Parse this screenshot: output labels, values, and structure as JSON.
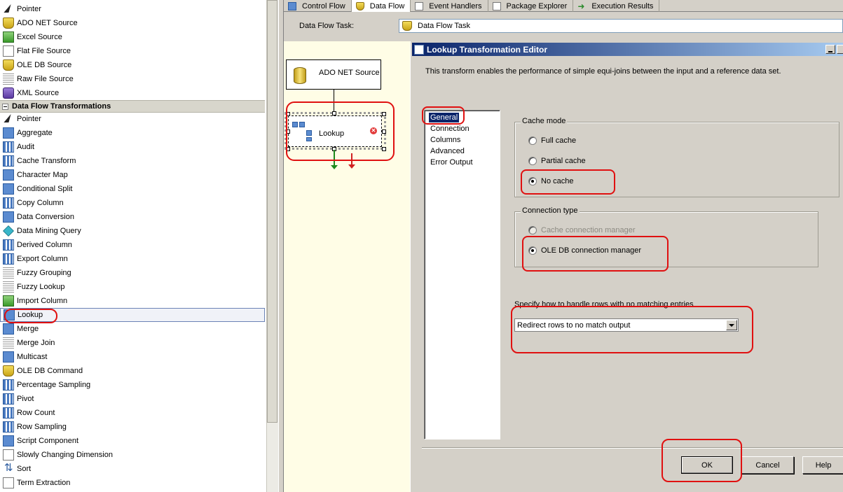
{
  "toolbox": {
    "sources": [
      {
        "label": "Pointer",
        "icon": "pointer-icon"
      },
      {
        "label": "ADO NET Source",
        "icon": "ado-net-source-icon"
      },
      {
        "label": "Excel Source",
        "icon": "excel-source-icon"
      },
      {
        "label": "Flat File Source",
        "icon": "flat-file-source-icon"
      },
      {
        "label": "OLE DB Source",
        "icon": "ole-db-source-icon"
      },
      {
        "label": "Raw File Source",
        "icon": "raw-file-source-icon"
      },
      {
        "label": "XML Source",
        "icon": "xml-source-icon"
      }
    ],
    "transformations_header": "Data Flow Transformations",
    "transformations": [
      {
        "label": "Pointer",
        "icon": "pointer-icon"
      },
      {
        "label": "Aggregate",
        "icon": "aggregate-icon"
      },
      {
        "label": "Audit",
        "icon": "audit-icon"
      },
      {
        "label": "Cache Transform",
        "icon": "cache-transform-icon"
      },
      {
        "label": "Character Map",
        "icon": "character-map-icon"
      },
      {
        "label": "Conditional Split",
        "icon": "conditional-split-icon"
      },
      {
        "label": "Copy Column",
        "icon": "copy-column-icon"
      },
      {
        "label": "Data Conversion",
        "icon": "data-conversion-icon"
      },
      {
        "label": "Data Mining Query",
        "icon": "data-mining-query-icon"
      },
      {
        "label": "Derived Column",
        "icon": "derived-column-icon"
      },
      {
        "label": "Export Column",
        "icon": "export-column-icon"
      },
      {
        "label": "Fuzzy Grouping",
        "icon": "fuzzy-grouping-icon"
      },
      {
        "label": "Fuzzy Lookup",
        "icon": "fuzzy-lookup-icon"
      },
      {
        "label": "Import Column",
        "icon": "import-column-icon"
      },
      {
        "label": "Lookup",
        "icon": "lookup-icon"
      },
      {
        "label": "Merge",
        "icon": "merge-icon"
      },
      {
        "label": "Merge Join",
        "icon": "merge-join-icon"
      },
      {
        "label": "Multicast",
        "icon": "multicast-icon"
      },
      {
        "label": "OLE DB Command",
        "icon": "ole-db-command-icon"
      },
      {
        "label": "Percentage Sampling",
        "icon": "percentage-sampling-icon"
      },
      {
        "label": "Pivot",
        "icon": "pivot-icon"
      },
      {
        "label": "Row Count",
        "icon": "row-count-icon"
      },
      {
        "label": "Row Sampling",
        "icon": "row-sampling-icon"
      },
      {
        "label": "Script Component",
        "icon": "script-component-icon"
      },
      {
        "label": "Slowly Changing Dimension",
        "icon": "slowly-changing-dimension-icon"
      },
      {
        "label": "Sort",
        "icon": "sort-icon"
      },
      {
        "label": "Term Extraction",
        "icon": "term-extraction-icon"
      }
    ],
    "selected": "Lookup"
  },
  "designer": {
    "tabs": [
      "Control Flow",
      "Data Flow",
      "Event Handlers",
      "Package Explorer",
      "Execution Results"
    ],
    "active_tab": "Data Flow",
    "task_label": "Data Flow Task:",
    "task_value": "Data Flow Task",
    "nodes": {
      "ado_net_source": "ADO NET Source",
      "lookup": "Lookup"
    }
  },
  "dialog": {
    "title": "Lookup Transformation Editor",
    "description": "This transform enables the performance of simple equi-joins between the input and a reference data set.",
    "nav": [
      "General",
      "Connection",
      "Columns",
      "Advanced",
      "Error Output"
    ],
    "nav_selected": "General",
    "cache_mode": {
      "title": "Cache mode",
      "options": [
        "Full cache",
        "Partial cache",
        "No cache"
      ],
      "selected": "No cache"
    },
    "connection_type": {
      "title": "Connection type",
      "options": [
        "Cache connection manager",
        "OLE DB connection manager"
      ],
      "selected": "OLE DB connection manager",
      "disabled": [
        "Cache connection manager"
      ]
    },
    "no_match": {
      "label": "Specify how to handle rows with no matching entries",
      "value": "Redirect rows to no match output"
    },
    "buttons": {
      "ok": "OK",
      "cancel": "Cancel",
      "help": "Help"
    }
  },
  "colors": {
    "title_gradient_start": "#0a246a",
    "canvas_background": "#fffde6",
    "annotation_red": "#e01010"
  }
}
